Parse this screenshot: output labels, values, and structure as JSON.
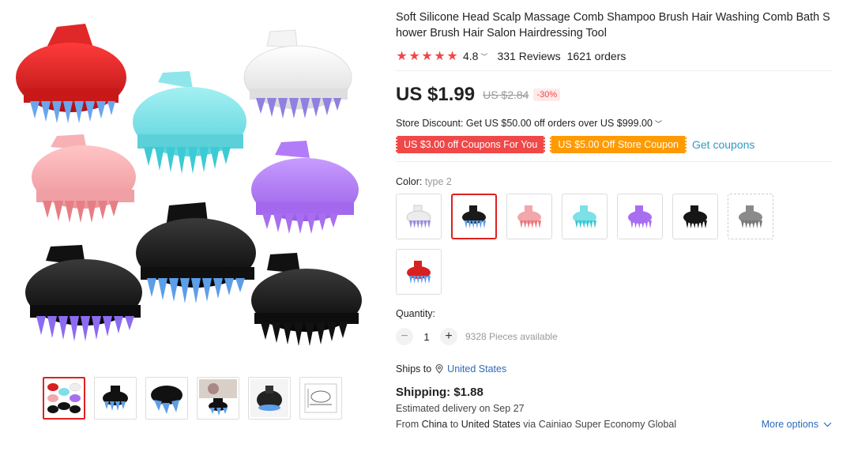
{
  "product": {
    "title": "Soft Silicone Head Scalp Massage Comb Shampoo Brush Hair Washing Comb Bath Shower Brush Hair Salon Hairdressing Tool",
    "rating": "4.8",
    "reviews": "331 Reviews",
    "orders": "1621 orders",
    "stars": 5
  },
  "price": {
    "current": "US $1.99",
    "original": "US $2.84",
    "discount": "-30%"
  },
  "store_discount": "Store Discount: Get US $50.00 off orders over US $999.00",
  "coupons": {
    "coupon1": "US $3.00 off Coupons For You",
    "coupon2": "US $5.00 Off Store Coupon",
    "get_coupons": "Get coupons"
  },
  "color": {
    "label": "Color:",
    "selected": "type 2",
    "options": [
      {
        "name": "white",
        "body": "#ececec",
        "teeth": "#9b88e0"
      },
      {
        "name": "black-blue",
        "body": "#1a1a1a",
        "teeth": "#5d9ee8"
      },
      {
        "name": "pink",
        "body": "#f2a7aa",
        "teeth": "#e8787e"
      },
      {
        "name": "cyan",
        "body": "#7de0e6",
        "teeth": "#3cc6d2"
      },
      {
        "name": "purple",
        "body": "#a86ef0",
        "teeth": "#a86ef0"
      },
      {
        "name": "black",
        "body": "#161616",
        "teeth": "#161616"
      },
      {
        "name": "grey",
        "body": "#8a8a8a",
        "teeth": "#777777"
      },
      {
        "name": "red",
        "body": "#d92020",
        "teeth": "#5d9ee8"
      }
    ],
    "selected_index": 1
  },
  "quantity": {
    "label": "Quantity:",
    "value": "1",
    "available": "9328 Pieces available"
  },
  "shipping": {
    "ships_to_label": "Ships to",
    "country": "United States",
    "cost": "Shipping: $1.88",
    "delivery": "Estimated delivery on Sep 27",
    "from_prefix": "From",
    "from": "China",
    "to_prefix": "to",
    "to": "United States",
    "via": "via Cainiao Super Economy Global",
    "more_options": "More options"
  },
  "gallery": {
    "thumbnail_count": 6,
    "active_index": 0
  },
  "colors": {
    "accent_red": "#f04848",
    "coupon_orange": "#ff9a00",
    "link_blue": "#2e6ab8"
  }
}
